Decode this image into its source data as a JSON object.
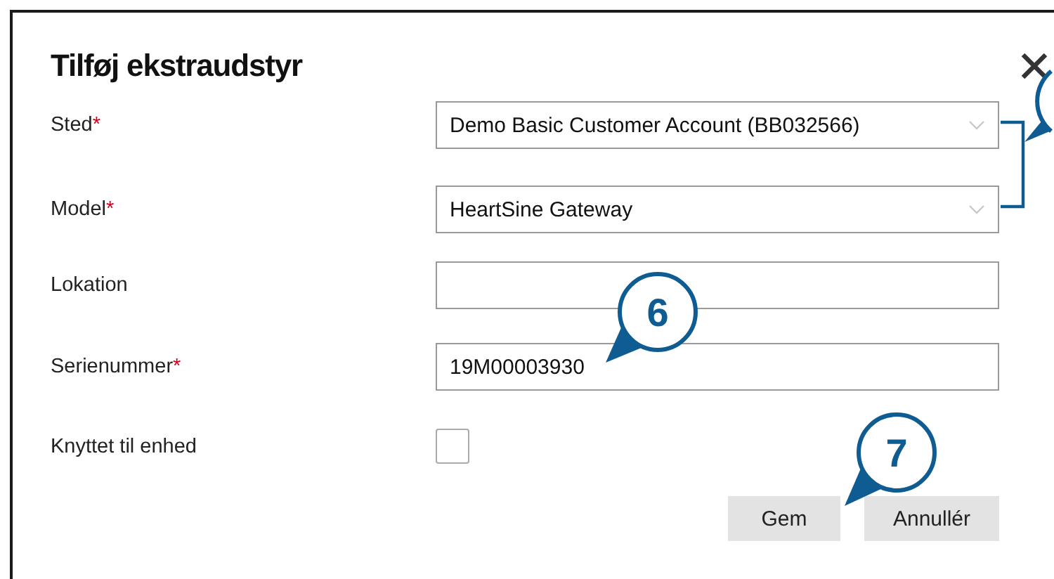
{
  "dialog": {
    "title": "Tilføj ekstraudstyr",
    "fields": [
      {
        "kind": "select",
        "label": "Sted",
        "required_mark": "*",
        "value": "Demo Basic Customer Account (BB032566)"
      },
      {
        "kind": "select",
        "label": "Model",
        "required_mark": "*",
        "value": "HeartSine Gateway"
      },
      {
        "kind": "text",
        "label": "Lokation"
      },
      {
        "kind": "text",
        "label": "Serienummer",
        "required_mark": "*",
        "value": "19M00003930"
      },
      {
        "kind": "checkbox",
        "label": "Knyttet til enhed",
        "checked": false
      }
    ],
    "buttons": [
      {
        "label": "Gem"
      },
      {
        "label": "Annullér"
      }
    ]
  },
  "callouts": [
    {
      "number": "6"
    },
    {
      "number": "7"
    }
  ]
}
